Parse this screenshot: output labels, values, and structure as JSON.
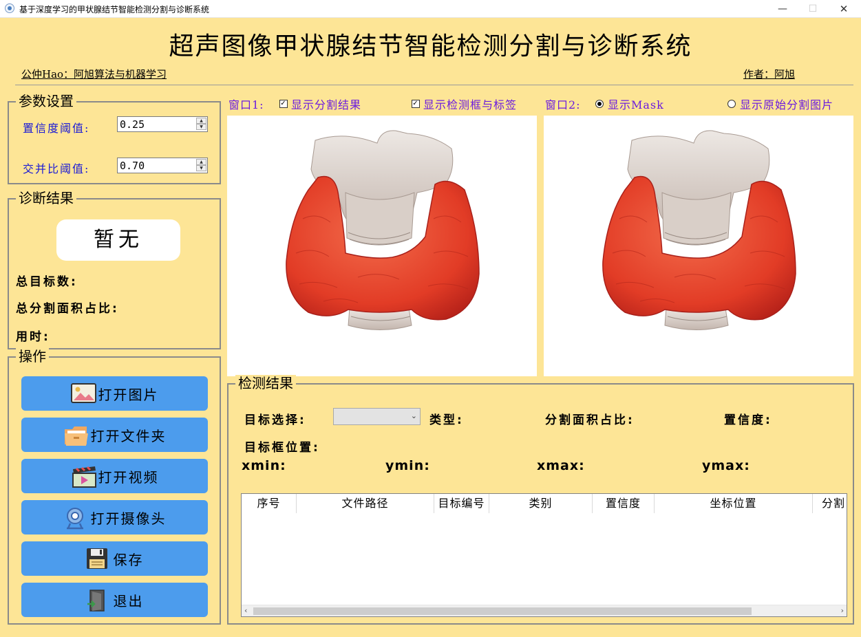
{
  "window": {
    "title": "基于深度学习的甲状腺结节智能检测分割与诊断系统",
    "controls": [
      "—",
      "☐",
      "✕"
    ]
  },
  "header": {
    "title": "超声图像甲状腺结节智能检测分割与诊断系统",
    "left_caption": "公仲Hao：阿旭算法与机器学习",
    "right_caption": "作者：阿旭"
  },
  "params": {
    "group_title": "参数设置",
    "confidence_label": "置信度阈值:",
    "confidence_value": "0.25",
    "iou_label": "交并比阈值:",
    "iou_value": "0.70"
  },
  "diagnosis": {
    "group_title": "诊断结果",
    "result": "暂无",
    "total_targets_label": "总目标数:",
    "total_area_label": "总分割面积占比:",
    "time_label": "用时:"
  },
  "operations": {
    "group_title": "操作",
    "buttons": [
      {
        "label": "打开图片",
        "icon": "image-icon"
      },
      {
        "label": "打开文件夹",
        "icon": "folder-icon"
      },
      {
        "label": "打开视频",
        "icon": "video-icon"
      },
      {
        "label": "打开摄像头",
        "icon": "camera-icon"
      },
      {
        "label": "保存",
        "icon": "save-icon"
      },
      {
        "label": "退出",
        "icon": "exit-icon"
      }
    ]
  },
  "view_options": {
    "window1_label": "窗口1:",
    "show_seg_label": "显示分割结果",
    "show_seg_checked": true,
    "show_box_label": "显示检测框与标签",
    "show_box_checked": true,
    "window2_label": "窗口2:",
    "show_mask_label": "显示Mask",
    "show_mask_selected": true,
    "show_original_label": "显示原始分割图片",
    "show_original_selected": false
  },
  "detection": {
    "group_title": "检测结果",
    "target_select_label": "目标选择:",
    "target_select_value": "",
    "type_label": "类型:",
    "area_label": "分割面积占比:",
    "confidence_label": "置信度:",
    "box_position_label": "目标框位置:",
    "xmin_label": "xmin:",
    "ymin_label": "ymin:",
    "xmax_label": "xmax:",
    "ymax_label": "ymax:"
  },
  "table": {
    "columns": [
      "序号",
      "文件路径",
      "目标编号",
      "类别",
      "置信度",
      "坐标位置",
      "分割"
    ],
    "rows": []
  },
  "colors": {
    "background": "#fde596",
    "button": "#4c9ced",
    "option_text": "#6a1adf",
    "param_text": "#1a1ad6"
  }
}
